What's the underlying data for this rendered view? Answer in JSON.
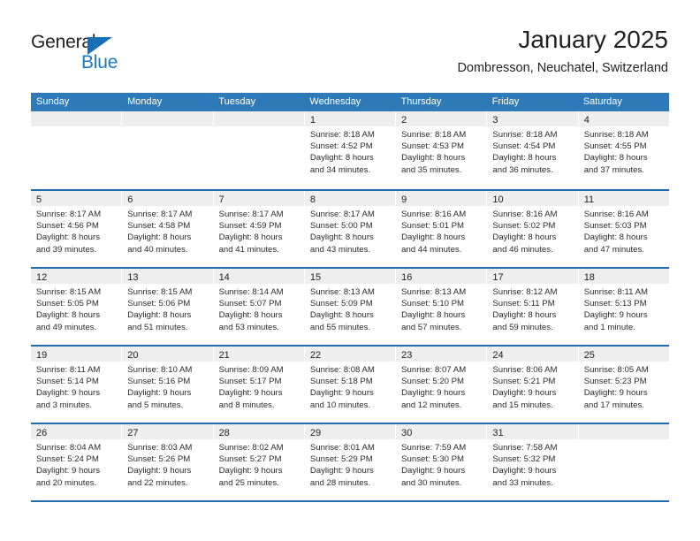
{
  "brand": {
    "name_primary": "General",
    "name_secondary": "Blue",
    "triangle_icon": "triangle-icon",
    "accent_color": "#1a6eb5"
  },
  "header": {
    "title": "January 2025",
    "subtitle": "Dombresson, Neuchatel, Switzerland"
  },
  "colors": {
    "header_band": "#2e7ab8",
    "row_rule": "#1f6cb0",
    "day_strip": "#eeeeee"
  },
  "weekdays": [
    "Sunday",
    "Monday",
    "Tuesday",
    "Wednesday",
    "Thursday",
    "Friday",
    "Saturday"
  ],
  "weeks": [
    [
      {
        "day": "",
        "lines": []
      },
      {
        "day": "",
        "lines": []
      },
      {
        "day": "",
        "lines": []
      },
      {
        "day": "1",
        "lines": [
          "Sunrise: 8:18 AM",
          "Sunset: 4:52 PM",
          "Daylight: 8 hours",
          "and 34 minutes."
        ]
      },
      {
        "day": "2",
        "lines": [
          "Sunrise: 8:18 AM",
          "Sunset: 4:53 PM",
          "Daylight: 8 hours",
          "and 35 minutes."
        ]
      },
      {
        "day": "3",
        "lines": [
          "Sunrise: 8:18 AM",
          "Sunset: 4:54 PM",
          "Daylight: 8 hours",
          "and 36 minutes."
        ]
      },
      {
        "day": "4",
        "lines": [
          "Sunrise: 8:18 AM",
          "Sunset: 4:55 PM",
          "Daylight: 8 hours",
          "and 37 minutes."
        ]
      }
    ],
    [
      {
        "day": "5",
        "lines": [
          "Sunrise: 8:17 AM",
          "Sunset: 4:56 PM",
          "Daylight: 8 hours",
          "and 39 minutes."
        ]
      },
      {
        "day": "6",
        "lines": [
          "Sunrise: 8:17 AM",
          "Sunset: 4:58 PM",
          "Daylight: 8 hours",
          "and 40 minutes."
        ]
      },
      {
        "day": "7",
        "lines": [
          "Sunrise: 8:17 AM",
          "Sunset: 4:59 PM",
          "Daylight: 8 hours",
          "and 41 minutes."
        ]
      },
      {
        "day": "8",
        "lines": [
          "Sunrise: 8:17 AM",
          "Sunset: 5:00 PM",
          "Daylight: 8 hours",
          "and 43 minutes."
        ]
      },
      {
        "day": "9",
        "lines": [
          "Sunrise: 8:16 AM",
          "Sunset: 5:01 PM",
          "Daylight: 8 hours",
          "and 44 minutes."
        ]
      },
      {
        "day": "10",
        "lines": [
          "Sunrise: 8:16 AM",
          "Sunset: 5:02 PM",
          "Daylight: 8 hours",
          "and 46 minutes."
        ]
      },
      {
        "day": "11",
        "lines": [
          "Sunrise: 8:16 AM",
          "Sunset: 5:03 PM",
          "Daylight: 8 hours",
          "and 47 minutes."
        ]
      }
    ],
    [
      {
        "day": "12",
        "lines": [
          "Sunrise: 8:15 AM",
          "Sunset: 5:05 PM",
          "Daylight: 8 hours",
          "and 49 minutes."
        ]
      },
      {
        "day": "13",
        "lines": [
          "Sunrise: 8:15 AM",
          "Sunset: 5:06 PM",
          "Daylight: 8 hours",
          "and 51 minutes."
        ]
      },
      {
        "day": "14",
        "lines": [
          "Sunrise: 8:14 AM",
          "Sunset: 5:07 PM",
          "Daylight: 8 hours",
          "and 53 minutes."
        ]
      },
      {
        "day": "15",
        "lines": [
          "Sunrise: 8:13 AM",
          "Sunset: 5:09 PM",
          "Daylight: 8 hours",
          "and 55 minutes."
        ]
      },
      {
        "day": "16",
        "lines": [
          "Sunrise: 8:13 AM",
          "Sunset: 5:10 PM",
          "Daylight: 8 hours",
          "and 57 minutes."
        ]
      },
      {
        "day": "17",
        "lines": [
          "Sunrise: 8:12 AM",
          "Sunset: 5:11 PM",
          "Daylight: 8 hours",
          "and 59 minutes."
        ]
      },
      {
        "day": "18",
        "lines": [
          "Sunrise: 8:11 AM",
          "Sunset: 5:13 PM",
          "Daylight: 9 hours",
          "and 1 minute."
        ]
      }
    ],
    [
      {
        "day": "19",
        "lines": [
          "Sunrise: 8:11 AM",
          "Sunset: 5:14 PM",
          "Daylight: 9 hours",
          "and 3 minutes."
        ]
      },
      {
        "day": "20",
        "lines": [
          "Sunrise: 8:10 AM",
          "Sunset: 5:16 PM",
          "Daylight: 9 hours",
          "and 5 minutes."
        ]
      },
      {
        "day": "21",
        "lines": [
          "Sunrise: 8:09 AM",
          "Sunset: 5:17 PM",
          "Daylight: 9 hours",
          "and 8 minutes."
        ]
      },
      {
        "day": "22",
        "lines": [
          "Sunrise: 8:08 AM",
          "Sunset: 5:18 PM",
          "Daylight: 9 hours",
          "and 10 minutes."
        ]
      },
      {
        "day": "23",
        "lines": [
          "Sunrise: 8:07 AM",
          "Sunset: 5:20 PM",
          "Daylight: 9 hours",
          "and 12 minutes."
        ]
      },
      {
        "day": "24",
        "lines": [
          "Sunrise: 8:06 AM",
          "Sunset: 5:21 PM",
          "Daylight: 9 hours",
          "and 15 minutes."
        ]
      },
      {
        "day": "25",
        "lines": [
          "Sunrise: 8:05 AM",
          "Sunset: 5:23 PM",
          "Daylight: 9 hours",
          "and 17 minutes."
        ]
      }
    ],
    [
      {
        "day": "26",
        "lines": [
          "Sunrise: 8:04 AM",
          "Sunset: 5:24 PM",
          "Daylight: 9 hours",
          "and 20 minutes."
        ]
      },
      {
        "day": "27",
        "lines": [
          "Sunrise: 8:03 AM",
          "Sunset: 5:26 PM",
          "Daylight: 9 hours",
          "and 22 minutes."
        ]
      },
      {
        "day": "28",
        "lines": [
          "Sunrise: 8:02 AM",
          "Sunset: 5:27 PM",
          "Daylight: 9 hours",
          "and 25 minutes."
        ]
      },
      {
        "day": "29",
        "lines": [
          "Sunrise: 8:01 AM",
          "Sunset: 5:29 PM",
          "Daylight: 9 hours",
          "and 28 minutes."
        ]
      },
      {
        "day": "30",
        "lines": [
          "Sunrise: 7:59 AM",
          "Sunset: 5:30 PM",
          "Daylight: 9 hours",
          "and 30 minutes."
        ]
      },
      {
        "day": "31",
        "lines": [
          "Sunrise: 7:58 AM",
          "Sunset: 5:32 PM",
          "Daylight: 9 hours",
          "and 33 minutes."
        ]
      },
      {
        "day": "",
        "lines": []
      }
    ]
  ]
}
